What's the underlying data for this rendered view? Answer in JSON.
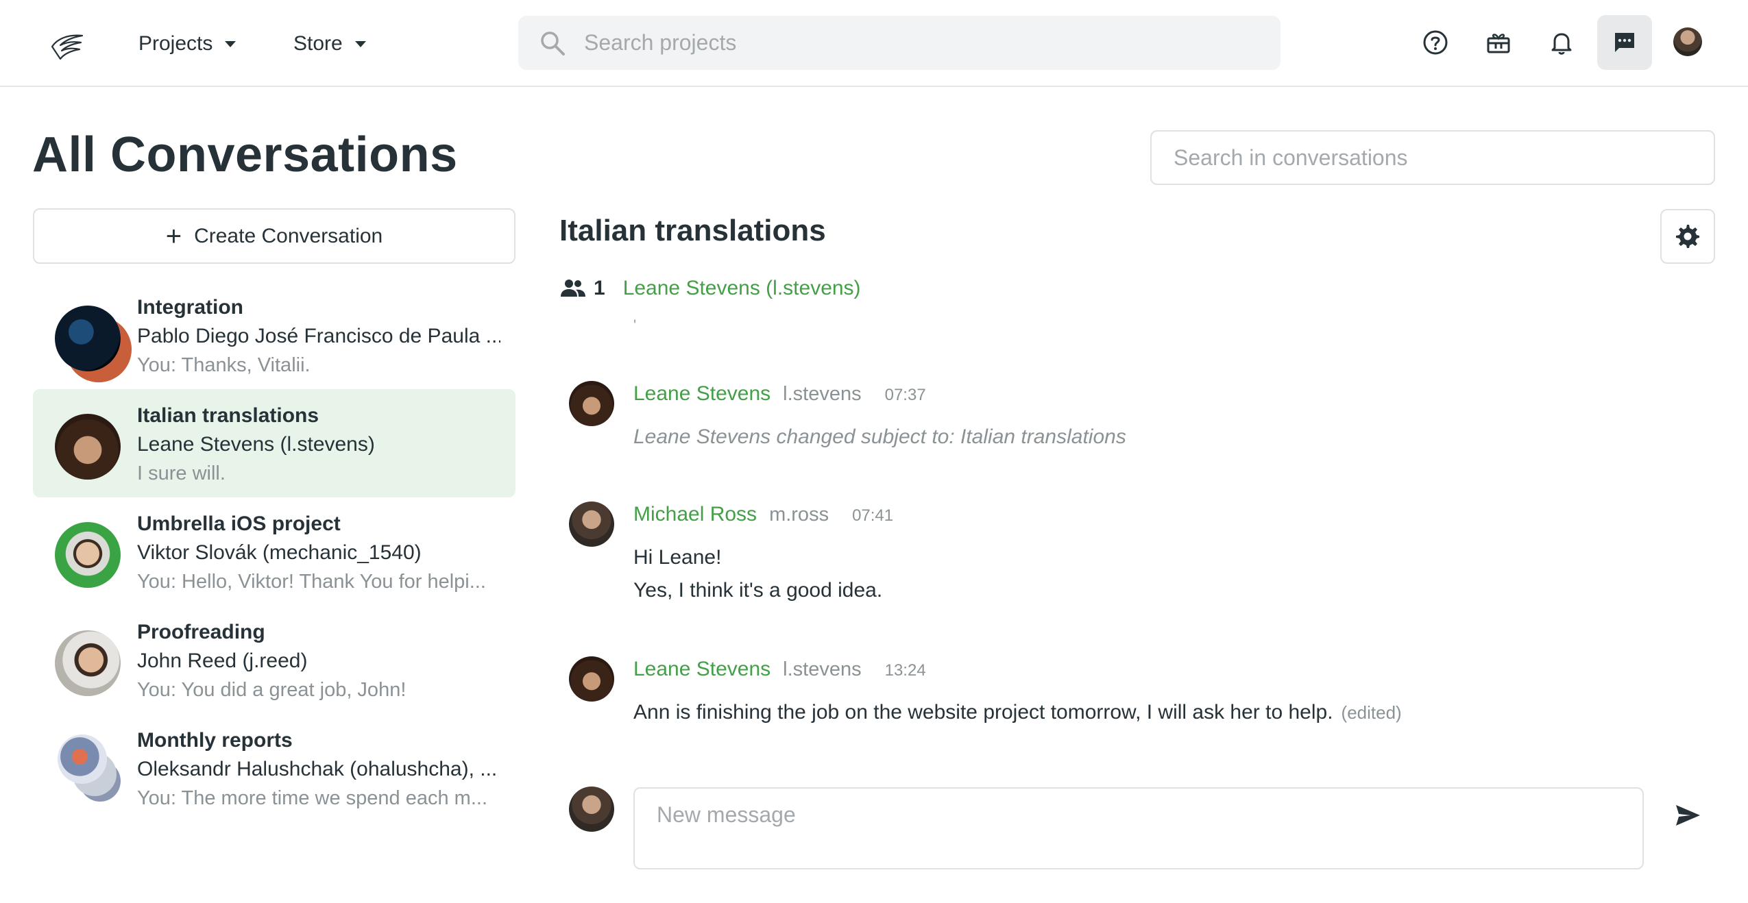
{
  "topbar": {
    "nav": [
      {
        "label": "Projects"
      },
      {
        "label": "Store"
      }
    ],
    "search_placeholder": "Search projects"
  },
  "page": {
    "title": "All Conversations",
    "search_placeholder": "Search in conversations",
    "create_label": "Create Conversation"
  },
  "conversations": [
    {
      "title": "Integration",
      "participants": "Pablo Diego José Francisco de Paula ...",
      "preview": "You: Thanks, Vitalii."
    },
    {
      "title": "Italian translations",
      "participants": "Leane Stevens (l.stevens)",
      "preview": "I sure will."
    },
    {
      "title": "Umbrella iOS project",
      "participants": "Viktor Slovák (mechanic_1540)",
      "preview": "You: Hello, Viktor! Thank You for helpi..."
    },
    {
      "title": "Proofreading",
      "participants": "John Reed (j.reed)",
      "preview": "You: You did a great job, John!"
    },
    {
      "title": "Monthly reports",
      "participants": "Oleksandr Halushchak (ohalushcha), ...",
      "preview": "You: The more time we spend each m..."
    }
  ],
  "chat": {
    "title": "Italian translations",
    "member_count": "1",
    "member": "Leane Stevens (l.stevens)",
    "mark": "'",
    "messages": [
      {
        "name": "Leane Stevens",
        "user": "l.stevens",
        "time": "07:37",
        "lines": [
          "Leane Stevens changed subject to: Italian translations"
        ]
      },
      {
        "name": "Michael Ross",
        "user": "m.ross",
        "time": "07:41",
        "lines": [
          "Hi Leane!",
          "Yes, I think it's a good idea."
        ]
      },
      {
        "name": "Leane Stevens",
        "user": "l.stevens",
        "time": "13:24",
        "lines": [
          "Ann is finishing the job on the website project tomorrow, I will ask her to help."
        ],
        "edited": "(edited)"
      }
    ],
    "composer_placeholder": "New message"
  },
  "colors": {
    "accent": "#43a047",
    "active_bg": "#e8f4ea",
    "text": "#263238",
    "muted": "#8a9296"
  },
  "icons": {
    "logo": "bird-logo-icon",
    "search": "search-icon",
    "help": "help-circle-icon",
    "gift": "gift-icon",
    "bell": "bell-icon",
    "chat": "chat-icon",
    "settings": "gear-icon",
    "members": "people-icon",
    "send": "send-icon"
  }
}
